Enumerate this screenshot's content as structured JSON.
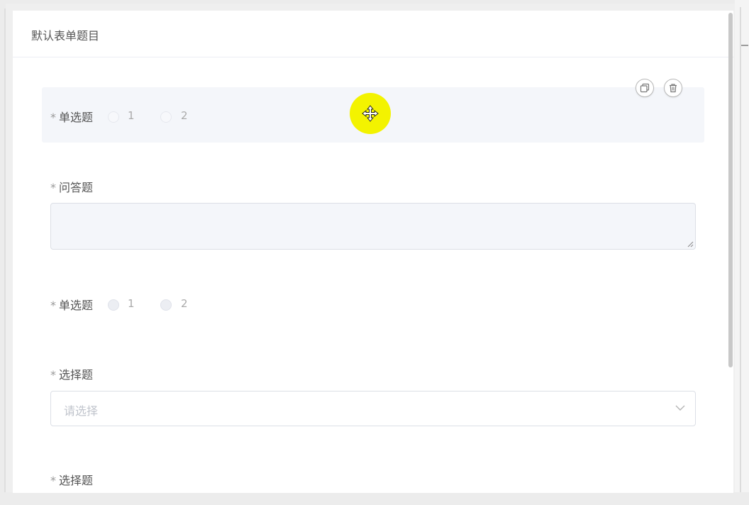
{
  "form": {
    "title": "默认表单题目",
    "required_mark": "*",
    "questions": [
      {
        "type": "radio",
        "label": "单选题",
        "options": [
          "1",
          "2"
        ],
        "selected": true
      },
      {
        "type": "textarea",
        "label": "问答题",
        "value": ""
      },
      {
        "type": "radio",
        "label": "单选题",
        "options": [
          "1",
          "2"
        ],
        "selected": false
      },
      {
        "type": "select",
        "label": "选择题",
        "placeholder": "请选择"
      },
      {
        "type": "select",
        "label": "选择题"
      }
    ]
  },
  "actions": {
    "copy_icon": "copy-icon",
    "delete_icon": "trash-icon"
  },
  "icons": {
    "resize": "resize-grip-icon",
    "dropdown": "chevron-down-icon",
    "cursor": "move-cursor-icon"
  },
  "colors": {
    "selected_background": "#f4f6fa",
    "cursor_highlight": "#f3f300"
  }
}
